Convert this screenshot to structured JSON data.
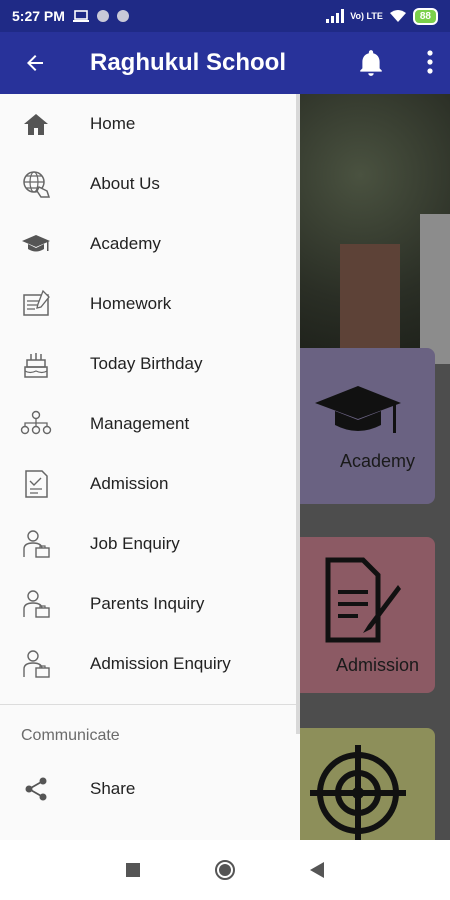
{
  "status": {
    "time": "5:27 PM",
    "network": "Vo) LTE",
    "battery": "88"
  },
  "app_bar": {
    "title": "Raghukul School"
  },
  "drawer": {
    "items": [
      {
        "label": "Home",
        "icon": "home-icon"
      },
      {
        "label": "About Us",
        "icon": "globe-hand-icon"
      },
      {
        "label": "Academy",
        "icon": "graduation-cap-icon"
      },
      {
        "label": "Homework",
        "icon": "homework-icon"
      },
      {
        "label": "Today Birthday",
        "icon": "birthday-cake-icon"
      },
      {
        "label": "Management",
        "icon": "org-chart-icon"
      },
      {
        "label": "Admission",
        "icon": "admission-form-icon"
      },
      {
        "label": "Job Enquiry",
        "icon": "person-briefcase-icon"
      },
      {
        "label": "Parents Inquiry",
        "icon": "person-briefcase-icon"
      },
      {
        "label": "Admission Enquiry",
        "icon": "person-briefcase-icon"
      }
    ],
    "section_title": "Communicate",
    "share_label": "Share"
  },
  "background": {
    "cards": [
      {
        "label": "Academy"
      },
      {
        "label": "Admission"
      }
    ]
  },
  "colors": {
    "status_bar": "#1f2a86",
    "app_bar": "#28329a",
    "drawer_bg": "#fafafa"
  }
}
